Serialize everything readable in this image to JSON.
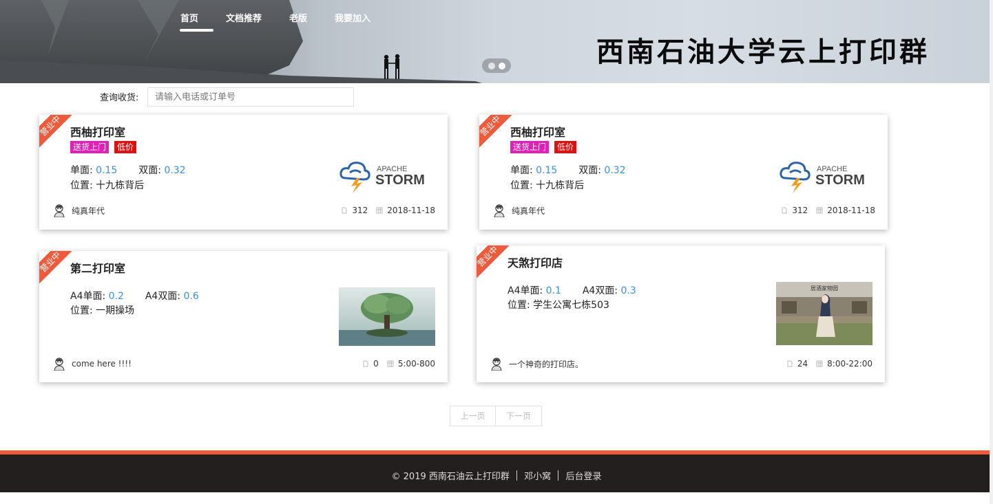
{
  "nav": {
    "items": [
      "首页",
      "文档推荐",
      "老版",
      "我要加入"
    ]
  },
  "banner": {
    "title": "西南石油大学云上打印群"
  },
  "search": {
    "label": "查询收货:",
    "placeholder": "请输入电话或订单号"
  },
  "cards": [
    {
      "ribbon": "营业中",
      "title": "西柚打印室",
      "tags": [
        "送货上门",
        "低价"
      ],
      "price1_label": "单面:",
      "price1": "0.15",
      "price2_label": "双面:",
      "price2": "0.32",
      "location_label": "位置:",
      "location": "十九栋背后",
      "logo_text_top": "APACHE",
      "logo_text_main": "STORM",
      "user": "纯真年代",
      "count": "312",
      "date": "2018-11-18"
    },
    {
      "ribbon": "营业中",
      "title": "西柚打印室",
      "tags": [
        "送货上门",
        "低价"
      ],
      "price1_label": "单面:",
      "price1": "0.15",
      "price2_label": "双面:",
      "price2": "0.32",
      "location_label": "位置:",
      "location": "十九栋背后",
      "logo_text_top": "APACHE",
      "logo_text_main": "STORM",
      "user": "纯真年代",
      "count": "312",
      "date": "2018-11-18"
    },
    {
      "ribbon": "营业中",
      "title": "第二打印室",
      "price1_label": "A4单面:",
      "price1": "0.2",
      "price2_label": "A4双面:",
      "price2": "0.6",
      "location_label": "位置:",
      "location": "一期操场",
      "user": "come here !!!!",
      "count": "0",
      "date": "5:00-800"
    },
    {
      "ribbon": "营业中",
      "title": "天煞打印店",
      "price1_label": "A4单面:",
      "price1": "0.1",
      "price2_label": "A4双面:",
      "price2": "0.3",
      "location_label": "位置:",
      "location": "学生公寓七栋503",
      "thumb_caption": "居酒家物园",
      "user": "一个神奇的打印店。",
      "count": "24",
      "date": "8:00-22:00"
    }
  ],
  "pager": {
    "prev": "上一页",
    "next": "下一页"
  },
  "footer": {
    "copyright": "© 2019 西南石油云上打印群",
    "author": "邓小窝",
    "admin": "后台登录"
  },
  "colors": {
    "accent": "#ee5a3a",
    "price": "#3b8fe0",
    "tag_delivery": "#e020b8",
    "tag_cheap": "#e01010",
    "footer_bg": "#231f1e"
  }
}
